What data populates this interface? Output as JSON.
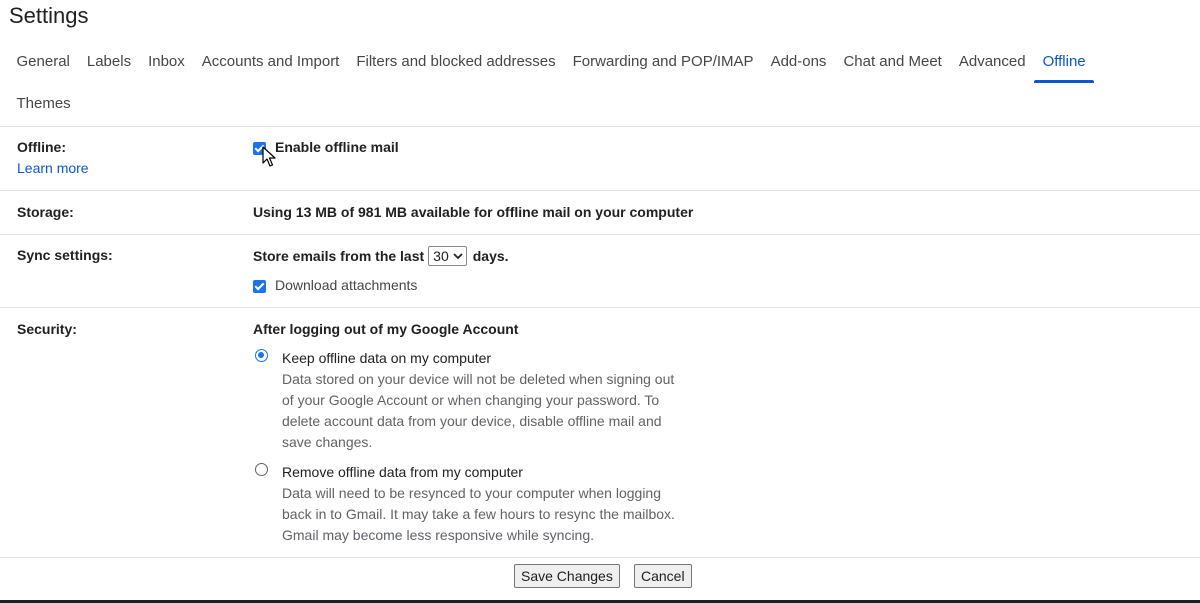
{
  "page": {
    "title": "Settings"
  },
  "tabs": [
    {
      "label": "General"
    },
    {
      "label": "Labels"
    },
    {
      "label": "Inbox"
    },
    {
      "label": "Accounts and Import"
    },
    {
      "label": "Filters and blocked addresses"
    },
    {
      "label": "Forwarding and POP/IMAP"
    },
    {
      "label": "Add-ons"
    },
    {
      "label": "Chat and Meet"
    },
    {
      "label": "Advanced"
    },
    {
      "label": "Offline",
      "active": true
    },
    {
      "label": "Themes"
    }
  ],
  "offline": {
    "label": "Offline:",
    "learn_more": "Learn more",
    "enable_label": "Enable offline mail",
    "enabled": true
  },
  "storage": {
    "label": "Storage:",
    "text": "Using 13 MB of 981 MB available for offline mail on your computer"
  },
  "sync": {
    "label": "Sync settings:",
    "prefix": "Store emails from the last",
    "days_value": "30",
    "suffix": "days.",
    "download_label": "Download attachments",
    "download_checked": true
  },
  "security": {
    "label": "Security:",
    "heading": "After logging out of my Google Account",
    "options": [
      {
        "title": "Keep offline data on my computer",
        "selected": true,
        "desc": [
          "Data stored on your device will not be deleted when signing out",
          "of your Google Account or when changing your password. To",
          "delete account data from your device, disable offline mail and",
          "save changes."
        ]
      },
      {
        "title": "Remove offline data from my computer",
        "selected": false,
        "desc": [
          "Data will need to be resynced to your computer when logging",
          "back in to Gmail. It may take a few hours to resync the mailbox.",
          "Gmail may become less responsive while syncing."
        ]
      }
    ]
  },
  "buttons": {
    "save": "Save Changes",
    "cancel": "Cancel"
  },
  "colors": {
    "accent": "#0b57d0",
    "checkbox": "#1a73e8",
    "divider": "#e3e3e3"
  },
  "icons": {
    "cursor": "mouse-pointer-icon"
  }
}
